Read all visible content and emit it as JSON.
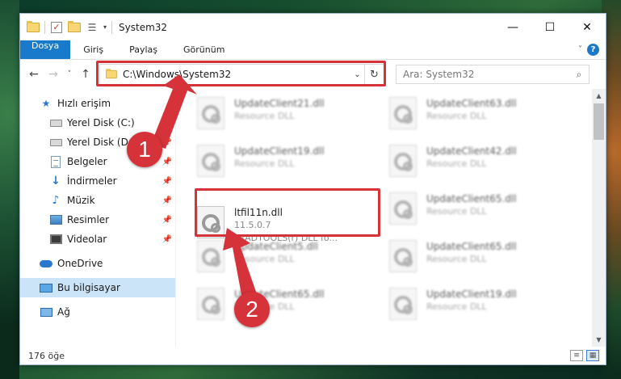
{
  "titlebar": {
    "title": "System32",
    "minimize": "—",
    "maximize": "☐",
    "close": "✕"
  },
  "ribbon": {
    "tabs": [
      "Dosya",
      "Giriş",
      "Paylaş",
      "Görünüm"
    ],
    "help": "?"
  },
  "nav": {
    "back": "←",
    "forward": "→",
    "recent": "˅",
    "up": "↑",
    "address": "C:\\Windows\\System32",
    "refresh": "↻",
    "search_placeholder": "Ara: System32"
  },
  "sidebar": {
    "items": [
      {
        "label": "Hızlı erişim",
        "icon": "star-icon"
      },
      {
        "label": "Yerel Disk (C:)",
        "icon": "drive-icon",
        "pinned": true
      },
      {
        "label": "Yerel Disk (D:)",
        "icon": "drive-icon",
        "pinned": true
      },
      {
        "label": "Belgeler",
        "icon": "documents-icon",
        "pinned": true
      },
      {
        "label": "İndirmeler",
        "icon": "downloads-icon",
        "pinned": true
      },
      {
        "label": "Müzik",
        "icon": "music-icon",
        "pinned": true
      },
      {
        "label": "Resimler",
        "icon": "pictures-icon",
        "pinned": true
      },
      {
        "label": "Videolar",
        "icon": "videos-icon",
        "pinned": true
      },
      {
        "label": "OneDrive",
        "icon": "cloud-icon"
      },
      {
        "label": "Bu bilgisayar",
        "icon": "computer-icon",
        "selected": true
      },
      {
        "label": "Ağ",
        "icon": "network-icon"
      }
    ]
  },
  "files": {
    "rows": [
      [
        {
          "name": "UpdateClient21.dll",
          "sub": "Resource DLL"
        },
        {
          "name": "UpdateClient63.dll",
          "sub": "Resource DLL"
        }
      ],
      [
        {
          "name": "UpdateClient19.dll",
          "sub": "Resource DLL"
        },
        {
          "name": "UpdateClient42.dll",
          "sub": "Resource DLL"
        }
      ],
      [
        null,
        {
          "name": "UpdateClient65.dll",
          "sub": "Resource DLL"
        }
      ],
      [
        {
          "name": "UpdateClient5.dll",
          "sub": "Resource DLL"
        },
        {
          "name": "UpdateClient65.dll",
          "sub": "Resource DLL"
        }
      ],
      [
        {
          "name": "UpdateClient65.dll",
          "sub": "Resource DLL"
        },
        {
          "name": "UpdateClient19.dll",
          "sub": "Resource DLL"
        }
      ]
    ],
    "selected": {
      "name": "ltfil11n.dll",
      "version": "11.5.0.7",
      "description": "LEADTOOLS(r) DLL fo..."
    }
  },
  "status": {
    "count": "176 öğe"
  },
  "callouts": {
    "one": "1",
    "two": "2"
  },
  "colors": {
    "accent": "#1979ca",
    "highlight": "#d5323a",
    "selected_bg": "#cce4f7"
  }
}
